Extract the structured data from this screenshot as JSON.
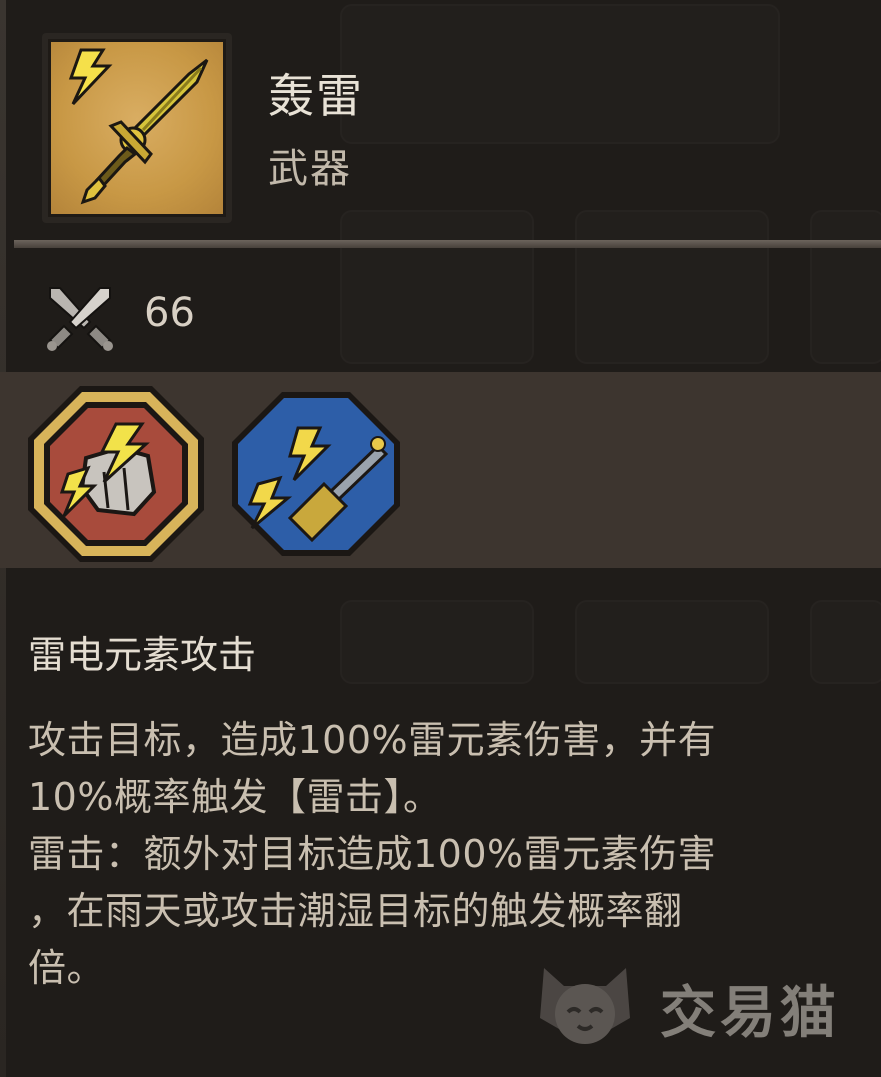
{
  "item": {
    "name": "轰雷",
    "type": "武器",
    "icon": "lightning-sword-icon"
  },
  "stats": {
    "attack_icon": "crossed-swords-icon",
    "attack_value": "66"
  },
  "skills": [
    {
      "icon": "thunder-fist-icon",
      "shape": "octagon",
      "color": "#a84b3c",
      "border": "#d8b45a"
    },
    {
      "icon": "lightning-hammer-icon",
      "shape": "octagon",
      "color": "#2d5ea8",
      "border": "#1d1a17"
    }
  ],
  "description": {
    "title": "雷电元素攻击",
    "lines": [
      "攻击目标，造成100%雷元素伤害，并有",
      "10%概率触发【雷击】。",
      "雷击：额外对目标造成100%雷元素伤害",
      "，在雨天或攻击潮湿目标的触发概率翻",
      "倍。"
    ]
  },
  "watermark": {
    "text": "交易猫",
    "icon": "cat-logo-icon"
  },
  "colors": {
    "background": "#1f1c19",
    "band": "#3d352f",
    "item_bg": "#c89845",
    "text": "#c9bfb0"
  }
}
